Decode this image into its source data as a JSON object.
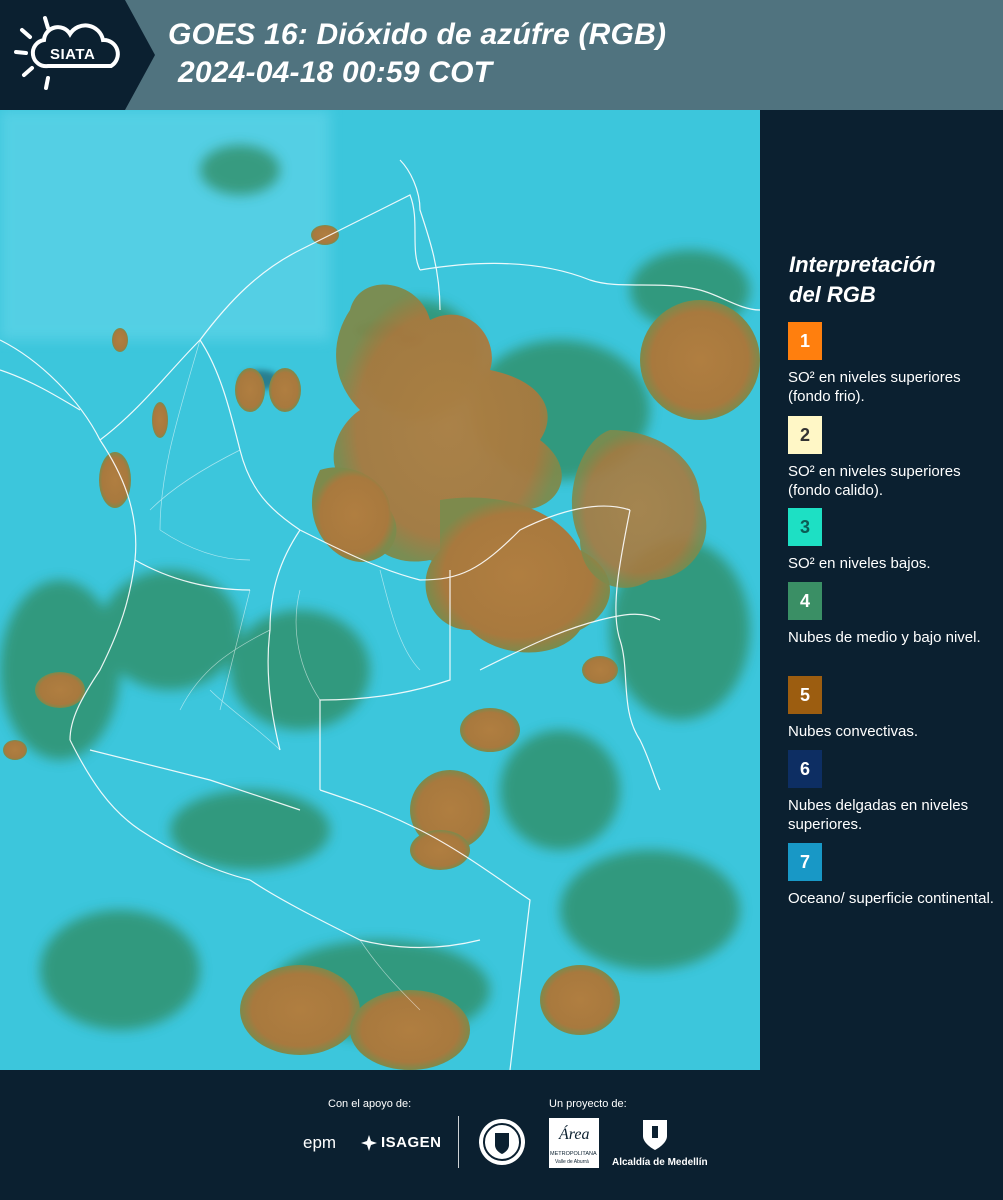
{
  "header": {
    "logo_text": "SIATA",
    "title_line1": "GOES 16: Dióxido de azúfre (RGB)",
    "title_line2": "2024-04-18 00:59 COT"
  },
  "legend": {
    "title_line1": "Interpretación",
    "title_line2": "del RGB",
    "items": [
      {
        "number": "1",
        "color": "#ff7f0e",
        "text_color": "#ffffff",
        "text": "SO² en niveles superiores (fondo frio)."
      },
      {
        "number": "2",
        "color": "#fff7c6",
        "text_color": "#333333",
        "text": "SO² en niveles superiores (fondo calido)."
      },
      {
        "number": "3",
        "color": "#1de0c4",
        "text_color": "#0b5c55",
        "text": "SO² en niveles bajos."
      },
      {
        "number": "4",
        "color": "#3a8f65",
        "text_color": "#ffffff",
        "text": "Nubes de medio y bajo nivel."
      },
      {
        "number": "5",
        "color": "#9c5d10",
        "text_color": "#ffffff",
        "text": "Nubes convectivas."
      },
      {
        "number": "6",
        "color": "#0d2e63",
        "text_color": "#ffffff",
        "text": "Nubes delgadas en niveles superiores."
      },
      {
        "number": "7",
        "color": "#1898c6",
        "text_color": "#ffffff",
        "text": "Oceano/ superficie continental."
      }
    ]
  },
  "footer": {
    "support_label": "Con el apoyo de:",
    "project_label": "Un proyecto de:",
    "sponsor_epm": "epm",
    "sponsor_isagen": "ISAGEN",
    "partner_area_line1": "Área",
    "partner_area_line2": "METROPOLITANA",
    "partner_area_line3": "Valle de Aburrá",
    "partner_alcaldia": "Alcaldía de Medellín"
  },
  "colors": {
    "header_bg": "#50737f",
    "panel_bg": "#0b2030",
    "map_cyan": "#3fc9dd",
    "map_convective": "#a9783d",
    "map_green": "#2f8a5e"
  }
}
